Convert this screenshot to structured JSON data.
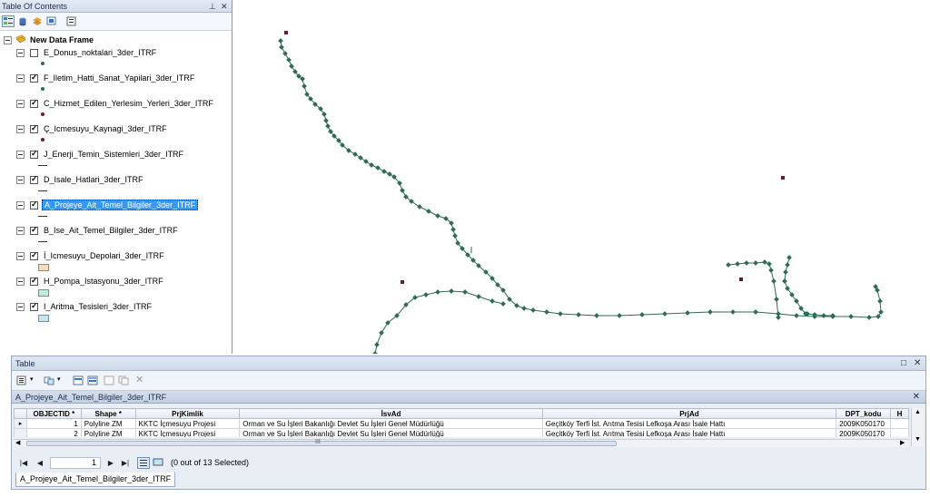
{
  "toc": {
    "title": "Table Of Contents",
    "frame_label": "New Data Frame",
    "layers": [
      {
        "label": "E_Donus_noktalari_3der_ITRF",
        "checked": false,
        "symbol": "dot",
        "color": "#2e6b57"
      },
      {
        "label": "F_Iletim_Hatti_Sanat_Yapilari_3der_ITRF",
        "checked": true,
        "symbol": "dot",
        "color": "#2e6b57"
      },
      {
        "label": "C_Hizmet_Edilen_Yerlesim_Yerleri_3der_ITRF",
        "checked": true,
        "symbol": "dot",
        "color": "#6b1a2a"
      },
      {
        "label": "Ç_Icmesuyu_Kaynagi_3der_ITRF",
        "checked": true,
        "symbol": "dot",
        "color": "#6b1a2a"
      },
      {
        "label": "J_Enerji_Temin_Sistemleri_3der_ITRF",
        "checked": true,
        "symbol": "line",
        "color": "#333344"
      },
      {
        "label": "D_Isale_Hatlari_3der_ITRF",
        "checked": true,
        "symbol": "line",
        "color": "#333344"
      },
      {
        "label": "A_Projeye_Ait_Temel_Bilgiler_3der_ITRF",
        "checked": true,
        "symbol": "line",
        "color": "#333344",
        "selected": true
      },
      {
        "label": "B_Ise_Ait_Temel_Bilgiler_3der_ITRF",
        "checked": true,
        "symbol": "line",
        "color": "#333344"
      },
      {
        "label": "İ_Icmesuyu_Depolari_3der_ITRF",
        "checked": true,
        "symbol": "poly",
        "color": "#f5dcb5"
      },
      {
        "label": "H_Pompa_Istasyonu_3der_ITRF",
        "checked": true,
        "symbol": "poly",
        "color": "#bfeee0"
      },
      {
        "label": "I_Aritma_Tesisleri_3der_ITRF",
        "checked": true,
        "symbol": "poly",
        "color": "#bfe8f0"
      }
    ]
  },
  "map": {
    "line_color": "#2f6b55",
    "vertex_color": "#2f6b55",
    "point_color": "#6b1a2a"
  },
  "table_window": {
    "title": "Table",
    "layer_tab_title": "A_Projeye_Ait_Temel_Bilgiler_3der_ITRF",
    "columns": [
      "OBJECTID *",
      "Shape *",
      "PrjKimlik",
      "İsvAd",
      "PrjAd",
      "DPT_kodu",
      "H"
    ],
    "rows": [
      [
        "1",
        "Polyline ZM",
        "KKTC İçmesuyu Projesi",
        "Orman ve Su İşleri Bakanlığı Devlet Su İşleri Genel Müdürlüğü",
        "Geçitköy Terfi İst. Arıtma Tesisi Lefkoşa Arası İsale Hattı",
        "2009K050170",
        ""
      ],
      [
        "2",
        "Polyline ZM",
        "KKTC İçmesuyu Projesi",
        "Orman ve Su İşleri Bakanlığı Devlet Su İşleri Genel Müdürlüğü",
        "Geçitköy Terfi İst. Arıtma Tesisi Lefkoşa Arası İsale Hattı",
        "2009K050170",
        ""
      ]
    ],
    "hscroll_label": "III",
    "nav": {
      "record": "1",
      "selection_status": "(0 out of 13 Selected)"
    },
    "bottom_tab_label": "A_Projeye_Ait_Temel_Bilgiler_3der_ITRF"
  }
}
